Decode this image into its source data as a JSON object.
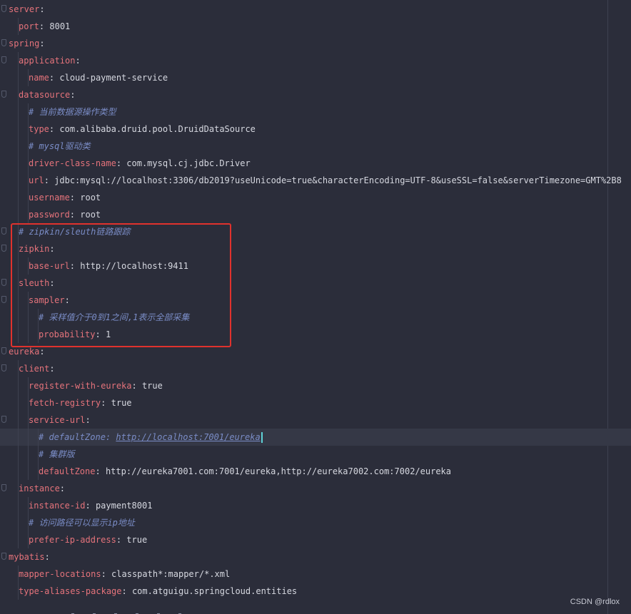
{
  "lines": [
    {
      "key": "server",
      "sep": ":",
      "value": ""
    },
    {
      "key": "port",
      "sep": ":",
      "value": " 8001"
    },
    {
      "key": "spring",
      "sep": ":",
      "value": ""
    },
    {
      "key": "application",
      "sep": ":",
      "value": ""
    },
    {
      "key": "name",
      "sep": ":",
      "value": " cloud-payment-service"
    },
    {
      "key": "datasource",
      "sep": ":",
      "value": ""
    },
    {
      "comment": "# 当前数据源操作类型"
    },
    {
      "key": "type",
      "sep": ":",
      "value": " com.alibaba.druid.pool.DruidDataSource"
    },
    {
      "comment": "# mysql驱动类"
    },
    {
      "key": "driver-class-name",
      "sep": ":",
      "value": " com.mysql.cj.jdbc.Driver"
    },
    {
      "key": "url",
      "sep": ":",
      "value": " jdbc:mysql://localhost:3306/db2019?useUnicode=true&characterEncoding=UTF-8&useSSL=false&serverTimezone=GMT%2B8"
    },
    {
      "key": "username",
      "sep": ":",
      "value": " root"
    },
    {
      "key": "password",
      "sep": ":",
      "value": " root"
    },
    {
      "comment": "# zipkin/sleuth链路跟踪"
    },
    {
      "key": "zipkin",
      "sep": ":",
      "value": ""
    },
    {
      "key": "base-url",
      "sep": ":",
      "value": " http://localhost:9411"
    },
    {
      "key": "sleuth",
      "sep": ":",
      "value": ""
    },
    {
      "key": "sampler",
      "sep": ":",
      "value": ""
    },
    {
      "comment": "# 采样值介于0到1之间,1表示全部采集"
    },
    {
      "key": "probability",
      "sep": ":",
      "value": " 1"
    },
    {
      "key": "eureka",
      "sep": ":",
      "value": ""
    },
    {
      "key": "client",
      "sep": ":",
      "value": ""
    },
    {
      "key": "register-with-eureka",
      "sep": ":",
      "value": " true"
    },
    {
      "key": "fetch-registry",
      "sep": ":",
      "value": " true"
    },
    {
      "key": "service-url",
      "sep": ":",
      "value": ""
    },
    {
      "comment": "# defaultZone: ",
      "link": "http://localhost:7001/eureka"
    },
    {
      "comment": "# 集群版"
    },
    {
      "key": "defaultZone",
      "sep": ":",
      "value": " http://eureka7001.com:7001/eureka,http://eureka7002.com:7002/eureka"
    },
    {
      "key": "instance",
      "sep": ":",
      "value": ""
    },
    {
      "key": "instance-id",
      "sep": ":",
      "value": " payment8001"
    },
    {
      "comment": "# 访问路径可以显示ip地址"
    },
    {
      "key": "prefer-ip-address",
      "sep": ":",
      "value": " true"
    },
    {
      "key": "mybatis",
      "sep": ":",
      "value": ""
    },
    {
      "key": "mapper-locations",
      "sep": ":",
      "value": " classpath*:mapper/*.xml"
    },
    {
      "key": "type-aliases-package",
      "sep": ":",
      "value": " com.atguigu.springcloud.entities"
    }
  ],
  "watermark": "CSDN @rdlox",
  "colors": {
    "background": "#2b2d3a",
    "key": "#e5737b",
    "comment": "#7a8cc6",
    "highlight_box": "#e0322d",
    "caret": "#5fd3d8"
  }
}
